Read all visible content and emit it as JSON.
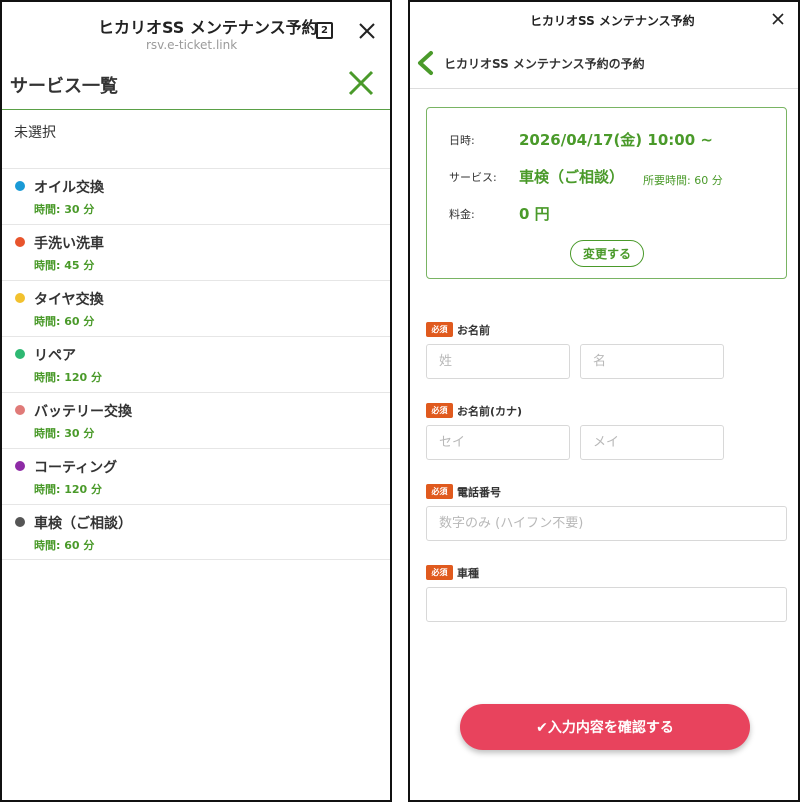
{
  "left_panel": {
    "title": "ヒカリオSS メンテナンス予約",
    "url": "rsv.e-ticket.link",
    "tab_count": "2",
    "services_heading": "サービス一覧",
    "unselected_label": "未選択",
    "services": [
      {
        "name": "オイル交換",
        "duration": "時間: 30 分",
        "color": "#1a9ad6"
      },
      {
        "name": "手洗い洗車",
        "duration": "時間: 45 分",
        "color": "#e8542c"
      },
      {
        "name": "タイヤ交換",
        "duration": "時間: 60 分",
        "color": "#f2c12e"
      },
      {
        "name": "リペア",
        "duration": "時間: 120 分",
        "color": "#2eb872"
      },
      {
        "name": "バッテリー交換",
        "duration": "時間: 30 分",
        "color": "#e07a78"
      },
      {
        "name": "コーティング",
        "duration": "時間: 120 分",
        "color": "#8e2ba6"
      },
      {
        "name": "車検（ご相談）",
        "duration": "時間: 60 分",
        "color": "#555555"
      }
    ]
  },
  "right_panel": {
    "title": "ヒカリオSS メンテナンス予約",
    "subtitle": "ヒカリオSS メンテナンス予約の予約",
    "summary": {
      "datetime_label": "日時:",
      "datetime_value": "2026/04/17(金) 10:00 ~",
      "service_label": "サービス:",
      "service_value": "車検（ご相談）",
      "required_time": "所要時間: 60 分",
      "fee_label": "料金:",
      "fee_value": "0 円",
      "change_button": "変更する"
    },
    "required_badge": "必須",
    "form": {
      "name_label": "お名前",
      "last_name_placeholder": "姓",
      "first_name_placeholder": "名",
      "kana_label": "お名前(カナ)",
      "kana_last_placeholder": "セイ",
      "kana_first_placeholder": "メイ",
      "phone_label": "電話番号",
      "phone_placeholder": "数字のみ (ハイフン不要)",
      "car_label": "車種",
      "car_placeholder": ""
    },
    "confirm_button": "✔入力内容を確認する"
  },
  "colors": {
    "accent_green": "#4a9a2a",
    "confirm_red": "#e8435d",
    "required_orange": "#e05a1e"
  },
  "icons": {
    "tabs": "tabs-count-icon",
    "close": "close-icon",
    "back": "chevron-left-icon"
  }
}
